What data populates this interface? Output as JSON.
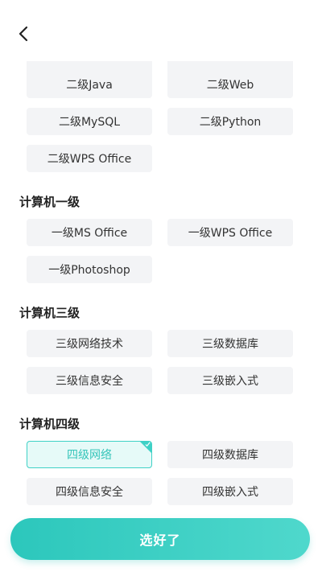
{
  "header": {
    "back_icon": "chevron-left-icon"
  },
  "groups": [
    {
      "title": "",
      "items": [
        "二级Java",
        "二级Web",
        "二级MySQL",
        "二级Python",
        "二级WPS Office"
      ]
    },
    {
      "title": "计算机一级",
      "items": [
        "一级MS Office",
        "一级WPS Office",
        "一级Photoshop"
      ]
    },
    {
      "title": "计算机三级",
      "items": [
        "三级网络技术",
        "三级数据库",
        "三级信息安全",
        "三级嵌入式"
      ]
    },
    {
      "title": "计算机四级",
      "items": [
        "四级网络",
        "四级数据库",
        "四级信息安全",
        "四级嵌入式"
      ]
    }
  ],
  "selected": "四级网络",
  "submit_label": "选好了",
  "colors": {
    "accent": "#3fd1c6",
    "chip_bg": "#f3f4f6",
    "selected_bg": "#e6faf8"
  }
}
